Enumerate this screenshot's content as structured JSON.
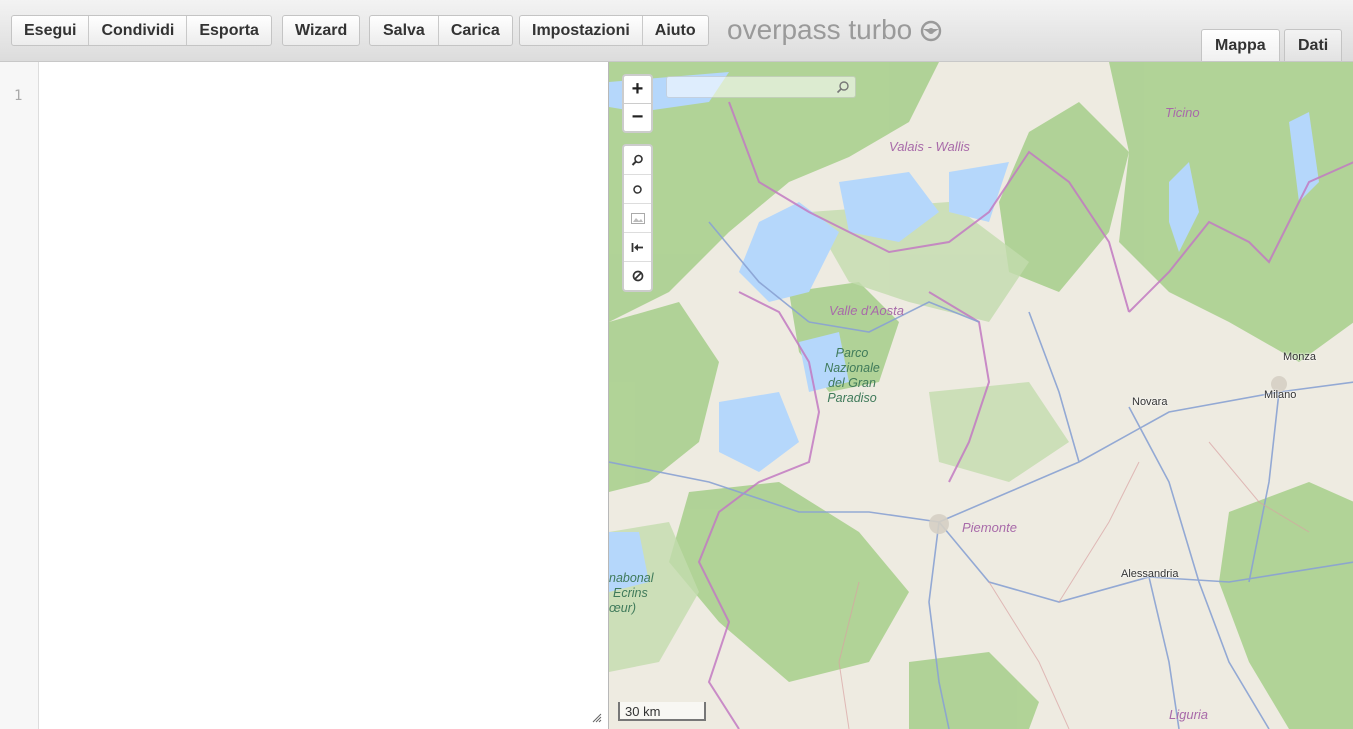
{
  "toolbar": {
    "group1": [
      "Esegui",
      "Condividi",
      "Esporta"
    ],
    "group2": [
      "Wizard"
    ],
    "group3": [
      "Salva",
      "Carica"
    ],
    "group4": [
      "Impostazioni",
      "Aiuto"
    ]
  },
  "app_title": "overpass turbo",
  "tabs": {
    "map": "Mappa",
    "data": "Dati"
  },
  "editor": {
    "line_number": "1"
  },
  "map": {
    "zoom_in": "+",
    "zoom_out": "−",
    "search_placeholder": "",
    "scale": "30 km",
    "labels": {
      "ticino": "Ticino",
      "valais": "Valais - Wallis",
      "valle_aosta": "Valle d'Aosta",
      "park_line1": "Parco",
      "park_line2": "Nazionale",
      "park_line3": "del Gran",
      "park_line4": "Paradiso",
      "monza": "Monza",
      "novara": "Novara",
      "milano": "Milano",
      "piemonte": "Piemonte",
      "ecrins_line1": "nabonal",
      "ecrins_line2": "Ecrins",
      "ecrins_line3": "œur)",
      "alessandria": "Alessandria",
      "liguria": "Liguria"
    },
    "colors": {
      "land": "#eeebe1",
      "forest": "#a9d28c",
      "glacier": "#b8dcff",
      "border": "#c06bc0",
      "road": "#7f9bd1"
    }
  }
}
